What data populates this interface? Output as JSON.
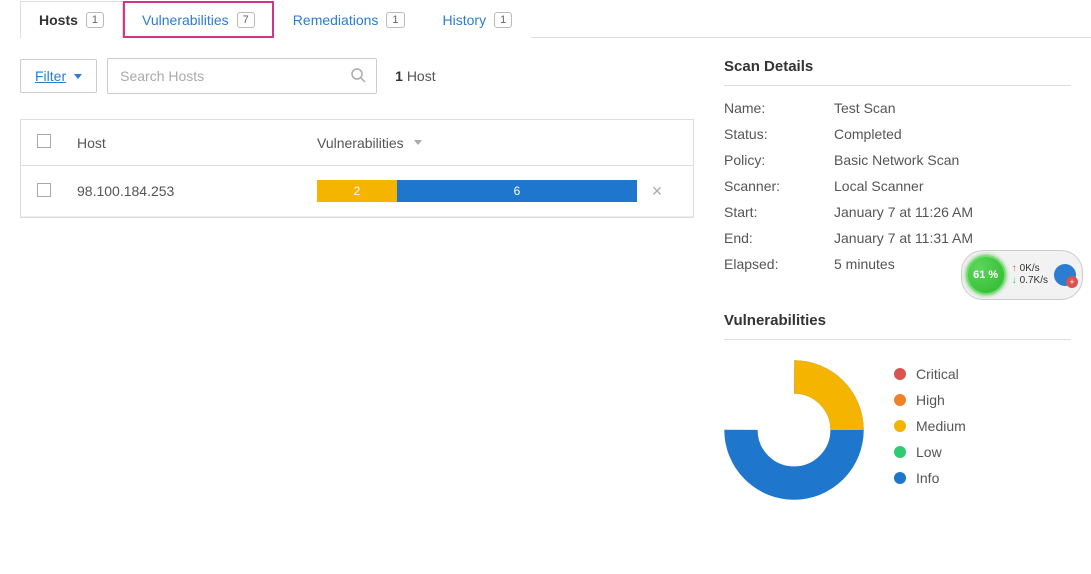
{
  "tabs": [
    {
      "label": "Hosts",
      "count": "1",
      "active": true
    },
    {
      "label": "Vulnerabilities",
      "count": "7",
      "highlight": true
    },
    {
      "label": "Remediations",
      "count": "1"
    },
    {
      "label": "History",
      "count": "1"
    }
  ],
  "toolbar": {
    "filter_label": "Filter",
    "search_placeholder": "Search Hosts",
    "host_count_num": "1",
    "host_count_label": "Host"
  },
  "table": {
    "col_host": "Host",
    "col_vuln": "Vulnerabilities",
    "rows": [
      {
        "host": "98.100.184.253",
        "medium": "2",
        "info": "6"
      }
    ]
  },
  "scan_details": {
    "title": "Scan Details",
    "name_label": "Name:",
    "name_value": "Test Scan",
    "status_label": "Status:",
    "status_value": "Completed",
    "policy_label": "Policy:",
    "policy_value": "Basic Network Scan",
    "scanner_label": "Scanner:",
    "scanner_value": "Local Scanner",
    "start_label": "Start:",
    "start_value": "January 7 at 11:26 AM",
    "end_label": "End:",
    "end_value": "January 7 at 11:31 AM",
    "elapsed_label": "Elapsed:",
    "elapsed_value": "5 minutes"
  },
  "vuln_section": {
    "title": "Vulnerabilities",
    "legend": {
      "critical": "Critical",
      "high": "High",
      "medium": "Medium",
      "low": "Low",
      "info": "Info"
    }
  },
  "widget": {
    "percent": "61 %",
    "up": "0K/s",
    "down": "0.7K/s"
  },
  "chart_data": {
    "type": "pie",
    "title": "Vulnerabilities",
    "series": [
      {
        "name": "Critical",
        "value": 0,
        "color": "#d9534f"
      },
      {
        "name": "High",
        "value": 0,
        "color": "#f0812b"
      },
      {
        "name": "Medium",
        "value": 2,
        "color": "#f4b400"
      },
      {
        "name": "Low",
        "value": 0,
        "color": "#2ecc71"
      },
      {
        "name": "Info",
        "value": 6,
        "color": "#1e77cc"
      }
    ]
  }
}
